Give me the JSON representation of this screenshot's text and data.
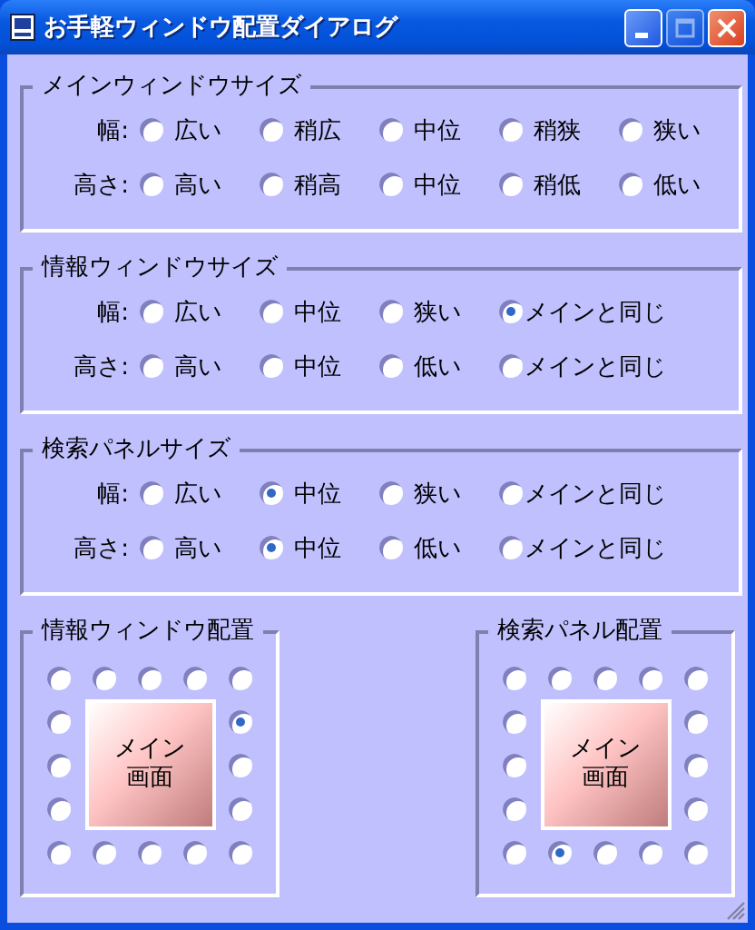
{
  "window": {
    "title": "お手軽ウィンドウ配置ダイアログ"
  },
  "size_groups": [
    {
      "title": "メインウィンドウサイズ",
      "rows": [
        {
          "label": "幅:",
          "options": [
            {
              "label": "広い",
              "selected": false
            },
            {
              "label": "稍広",
              "selected": false
            },
            {
              "label": "中位",
              "selected": false
            },
            {
              "label": "稍狭",
              "selected": false
            },
            {
              "label": "狭い",
              "selected": false
            }
          ]
        },
        {
          "label": "高さ:",
          "options": [
            {
              "label": "高い",
              "selected": false
            },
            {
              "label": "稍高",
              "selected": false
            },
            {
              "label": "中位",
              "selected": false
            },
            {
              "label": "稍低",
              "selected": false
            },
            {
              "label": "低い",
              "selected": false
            }
          ]
        }
      ]
    },
    {
      "title": "情報ウィンドウサイズ",
      "rows": [
        {
          "label": "幅:",
          "options": [
            {
              "label": "広い",
              "selected": false
            },
            {
              "label": "中位",
              "selected": false
            },
            {
              "label": "狭い",
              "selected": false
            },
            {
              "label": "メインと同じ",
              "selected": true
            }
          ]
        },
        {
          "label": "高さ:",
          "options": [
            {
              "label": "高い",
              "selected": false
            },
            {
              "label": "中位",
              "selected": false
            },
            {
              "label": "低い",
              "selected": false
            },
            {
              "label": "メインと同じ",
              "selected": false
            }
          ]
        }
      ]
    },
    {
      "title": "検索パネルサイズ",
      "rows": [
        {
          "label": "幅:",
          "options": [
            {
              "label": "広い",
              "selected": false
            },
            {
              "label": "中位",
              "selected": true
            },
            {
              "label": "狭い",
              "selected": false
            },
            {
              "label": "メインと同じ",
              "selected": false
            }
          ]
        },
        {
          "label": "高さ:",
          "options": [
            {
              "label": "高い",
              "selected": false
            },
            {
              "label": "中位",
              "selected": true
            },
            {
              "label": "低い",
              "selected": false
            },
            {
              "label": "メインと同じ",
              "selected": false
            }
          ]
        }
      ]
    }
  ],
  "placement_groups": [
    {
      "title": "情報ウィンドウ配置",
      "center_label": [
        "メイン",
        "画面"
      ],
      "positions": [
        {
          "selected": false
        },
        {
          "selected": false
        },
        {
          "selected": false
        },
        {
          "selected": false
        },
        {
          "selected": false
        },
        {
          "selected": false
        },
        {
          "selected": true
        },
        {
          "selected": false
        },
        {
          "selected": false
        },
        {
          "selected": false
        },
        {
          "selected": false
        },
        {
          "selected": false
        },
        {
          "selected": false
        },
        {
          "selected": false
        },
        {
          "selected": false
        },
        {
          "selected": false
        }
      ]
    },
    {
      "title": "検索パネル配置",
      "center_label": [
        "メイン",
        "画面"
      ],
      "positions": [
        {
          "selected": false
        },
        {
          "selected": false
        },
        {
          "selected": false
        },
        {
          "selected": false
        },
        {
          "selected": false
        },
        {
          "selected": false
        },
        {
          "selected": false
        },
        {
          "selected": false
        },
        {
          "selected": false
        },
        {
          "selected": false
        },
        {
          "selected": false
        },
        {
          "selected": false
        },
        {
          "selected": true
        },
        {
          "selected": false
        },
        {
          "selected": false
        },
        {
          "selected": false
        }
      ]
    }
  ]
}
